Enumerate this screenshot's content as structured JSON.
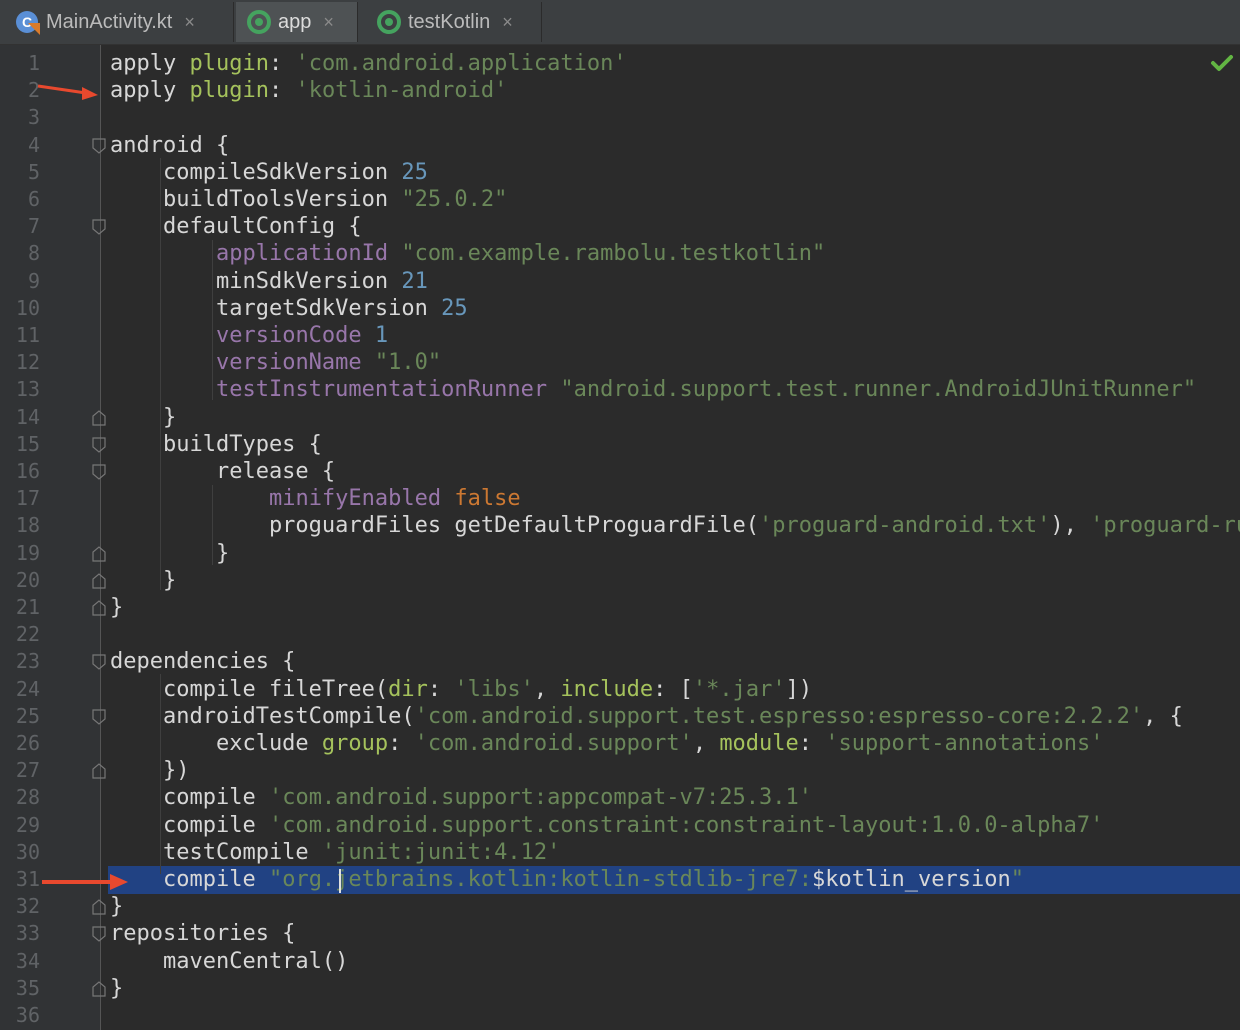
{
  "tabs": [
    {
      "label": "MainActivity.kt",
      "icon": "kotlin-file-icon",
      "active": false
    },
    {
      "label": "app",
      "icon": "gradle-module-icon",
      "active": true
    },
    {
      "label": "testKotlin",
      "icon": "gradle-module-icon",
      "active": false
    }
  ],
  "close_glyph": "×",
  "status_icon": "check-icon",
  "colors": {
    "keyword": "#cc7832",
    "string": "#6a8759",
    "number": "#6897bb",
    "property": "#9876aa",
    "highlight": "#214283",
    "arrow": "#e8492e",
    "check": "#62b543"
  },
  "line_numbers": [
    "1",
    "2",
    "3",
    "4",
    "5",
    "6",
    "7",
    "8",
    "9",
    "10",
    "11",
    "12",
    "13",
    "14",
    "15",
    "16",
    "17",
    "18",
    "19",
    "20",
    "21",
    "22",
    "23",
    "24",
    "25",
    "26",
    "27",
    "28",
    "29",
    "30",
    "31",
    "32",
    "33",
    "34",
    "35",
    "36"
  ],
  "code": [
    [
      {
        "t": "apply ",
        "c": "plain"
      },
      {
        "t": "plugin",
        "c": "arg"
      },
      {
        "t": ": ",
        "c": "plain"
      },
      {
        "t": "'com.android.application'",
        "c": "str"
      }
    ],
    [
      {
        "t": "apply ",
        "c": "plain"
      },
      {
        "t": "plugin",
        "c": "arg"
      },
      {
        "t": ": ",
        "c": "plain"
      },
      {
        "t": "'kotlin-android'",
        "c": "str"
      }
    ],
    [],
    [
      {
        "t": "android {",
        "c": "plain"
      }
    ],
    [
      {
        "t": "    compileSdkVersion ",
        "c": "plain"
      },
      {
        "t": "25",
        "c": "num"
      }
    ],
    [
      {
        "t": "    buildToolsVersion ",
        "c": "plain"
      },
      {
        "t": "\"25.0.2\"",
        "c": "str"
      }
    ],
    [
      {
        "t": "    defaultConfig {",
        "c": "plain"
      }
    ],
    [
      {
        "t": "        ",
        "c": "plain"
      },
      {
        "t": "applicationId ",
        "c": "prop"
      },
      {
        "t": "\"com.example.rambolu.testkotlin\"",
        "c": "str"
      }
    ],
    [
      {
        "t": "        minSdkVersion ",
        "c": "plain"
      },
      {
        "t": "21",
        "c": "num"
      }
    ],
    [
      {
        "t": "        targetSdkVersion ",
        "c": "plain"
      },
      {
        "t": "25",
        "c": "num"
      }
    ],
    [
      {
        "t": "        ",
        "c": "plain"
      },
      {
        "t": "versionCode ",
        "c": "prop"
      },
      {
        "t": "1",
        "c": "num"
      }
    ],
    [
      {
        "t": "        ",
        "c": "plain"
      },
      {
        "t": "versionName ",
        "c": "prop"
      },
      {
        "t": "\"1.0\"",
        "c": "str"
      }
    ],
    [
      {
        "t": "        ",
        "c": "plain"
      },
      {
        "t": "testInstrumentationRunner ",
        "c": "prop"
      },
      {
        "t": "\"android.support.test.runner.AndroidJUnitRunner\"",
        "c": "str"
      }
    ],
    [
      {
        "t": "    }",
        "c": "plain"
      }
    ],
    [
      {
        "t": "    buildTypes {",
        "c": "plain"
      }
    ],
    [
      {
        "t": "        release {",
        "c": "plain"
      }
    ],
    [
      {
        "t": "            ",
        "c": "plain"
      },
      {
        "t": "minifyEnabled ",
        "c": "prop"
      },
      {
        "t": "false",
        "c": "kw"
      }
    ],
    [
      {
        "t": "            proguardFiles getDefaultProguardFile(",
        "c": "plain"
      },
      {
        "t": "'proguard-android.txt'",
        "c": "str"
      },
      {
        "t": "), ",
        "c": "plain"
      },
      {
        "t": "'proguard-rules",
        "c": "str"
      }
    ],
    [
      {
        "t": "        }",
        "c": "plain"
      }
    ],
    [
      {
        "t": "    }",
        "c": "plain"
      }
    ],
    [
      {
        "t": "}",
        "c": "plain"
      }
    ],
    [],
    [
      {
        "t": "dependencies {",
        "c": "plain"
      }
    ],
    [
      {
        "t": "    compile fileTree(",
        "c": "plain"
      },
      {
        "t": "dir",
        "c": "arg"
      },
      {
        "t": ": ",
        "c": "plain"
      },
      {
        "t": "'libs'",
        "c": "str"
      },
      {
        "t": ", ",
        "c": "plain"
      },
      {
        "t": "include",
        "c": "arg"
      },
      {
        "t": ": [",
        "c": "plain"
      },
      {
        "t": "'*.jar'",
        "c": "str"
      },
      {
        "t": "])",
        "c": "plain"
      }
    ],
    [
      {
        "t": "    androidTestCompile(",
        "c": "plain"
      },
      {
        "t": "'com.android.support.test.espresso:espresso-core:2.2.2'",
        "c": "str"
      },
      {
        "t": ", {",
        "c": "plain"
      }
    ],
    [
      {
        "t": "        exclude ",
        "c": "plain"
      },
      {
        "t": "group",
        "c": "arg"
      },
      {
        "t": ": ",
        "c": "plain"
      },
      {
        "t": "'com.android.support'",
        "c": "str"
      },
      {
        "t": ", ",
        "c": "plain"
      },
      {
        "t": "module",
        "c": "arg"
      },
      {
        "t": ": ",
        "c": "plain"
      },
      {
        "t": "'support-annotations'",
        "c": "str"
      }
    ],
    [
      {
        "t": "    })",
        "c": "plain"
      }
    ],
    [
      {
        "t": "    compile ",
        "c": "plain"
      },
      {
        "t": "'com.android.support:appcompat-v7:25.3.1'",
        "c": "str"
      }
    ],
    [
      {
        "t": "    compile ",
        "c": "plain"
      },
      {
        "t": "'com.android.support.constraint:constraint-layout:1.0.0-alpha7'",
        "c": "str"
      }
    ],
    [
      {
        "t": "    testCompile ",
        "c": "plain"
      },
      {
        "t": "'junit:junit:4.12'",
        "c": "str"
      }
    ],
    [
      {
        "t": "    compile ",
        "c": "plain"
      },
      {
        "t": "\"org.jetbrains.kotlin:kotlin-stdlib-jre7:",
        "c": "str"
      },
      {
        "t": "$kotlin_version",
        "c": "plain"
      },
      {
        "t": "\"",
        "c": "str"
      }
    ],
    [
      {
        "t": "}",
        "c": "plain"
      }
    ],
    [
      {
        "t": "repositories {",
        "c": "plain"
      }
    ],
    [
      {
        "t": "    mavenCentral()",
        "c": "plain"
      }
    ],
    [
      {
        "t": "}",
        "c": "plain"
      }
    ],
    []
  ],
  "fold_markers": [
    {
      "line": 4,
      "kind": "open"
    },
    {
      "line": 7,
      "kind": "open"
    },
    {
      "line": 14,
      "kind": "close"
    },
    {
      "line": 15,
      "kind": "open"
    },
    {
      "line": 16,
      "kind": "open"
    },
    {
      "line": 19,
      "kind": "close"
    },
    {
      "line": 20,
      "kind": "close"
    },
    {
      "line": 21,
      "kind": "close"
    },
    {
      "line": 23,
      "kind": "open"
    },
    {
      "line": 25,
      "kind": "open"
    },
    {
      "line": 27,
      "kind": "close"
    },
    {
      "line": 32,
      "kind": "close"
    },
    {
      "line": 33,
      "kind": "open"
    },
    {
      "line": 35,
      "kind": "close"
    }
  ],
  "highlighted_line": 31,
  "annotation_arrows": [
    2,
    31
  ]
}
